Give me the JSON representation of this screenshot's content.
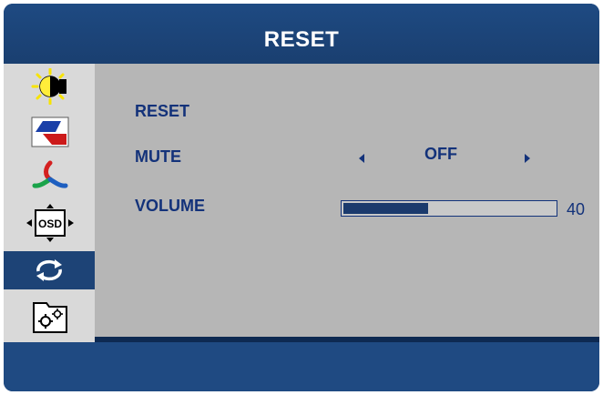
{
  "title": "RESET",
  "sidebar": {
    "items": [
      {
        "icon": "brightness-contrast-icon",
        "active": false
      },
      {
        "icon": "color-icon",
        "active": false
      },
      {
        "icon": "rgb-adjust-icon",
        "active": false
      },
      {
        "icon": "osd-position-icon",
        "active": false,
        "label": "OSD"
      },
      {
        "icon": "reset-icon",
        "active": true
      },
      {
        "icon": "setup-gears-icon",
        "active": false
      }
    ]
  },
  "menu": {
    "reset_label": "RESET",
    "mute_label": "MUTE",
    "mute_value": "OFF",
    "volume_label": "VOLUME",
    "volume_value": "40",
    "volume_fraction": 0.4
  },
  "colors": {
    "frame_blue": "#1d4376",
    "content_gray": "#b6b6b6",
    "text_blue": "#13327a",
    "sidebar_gray": "#d9d9d9"
  }
}
